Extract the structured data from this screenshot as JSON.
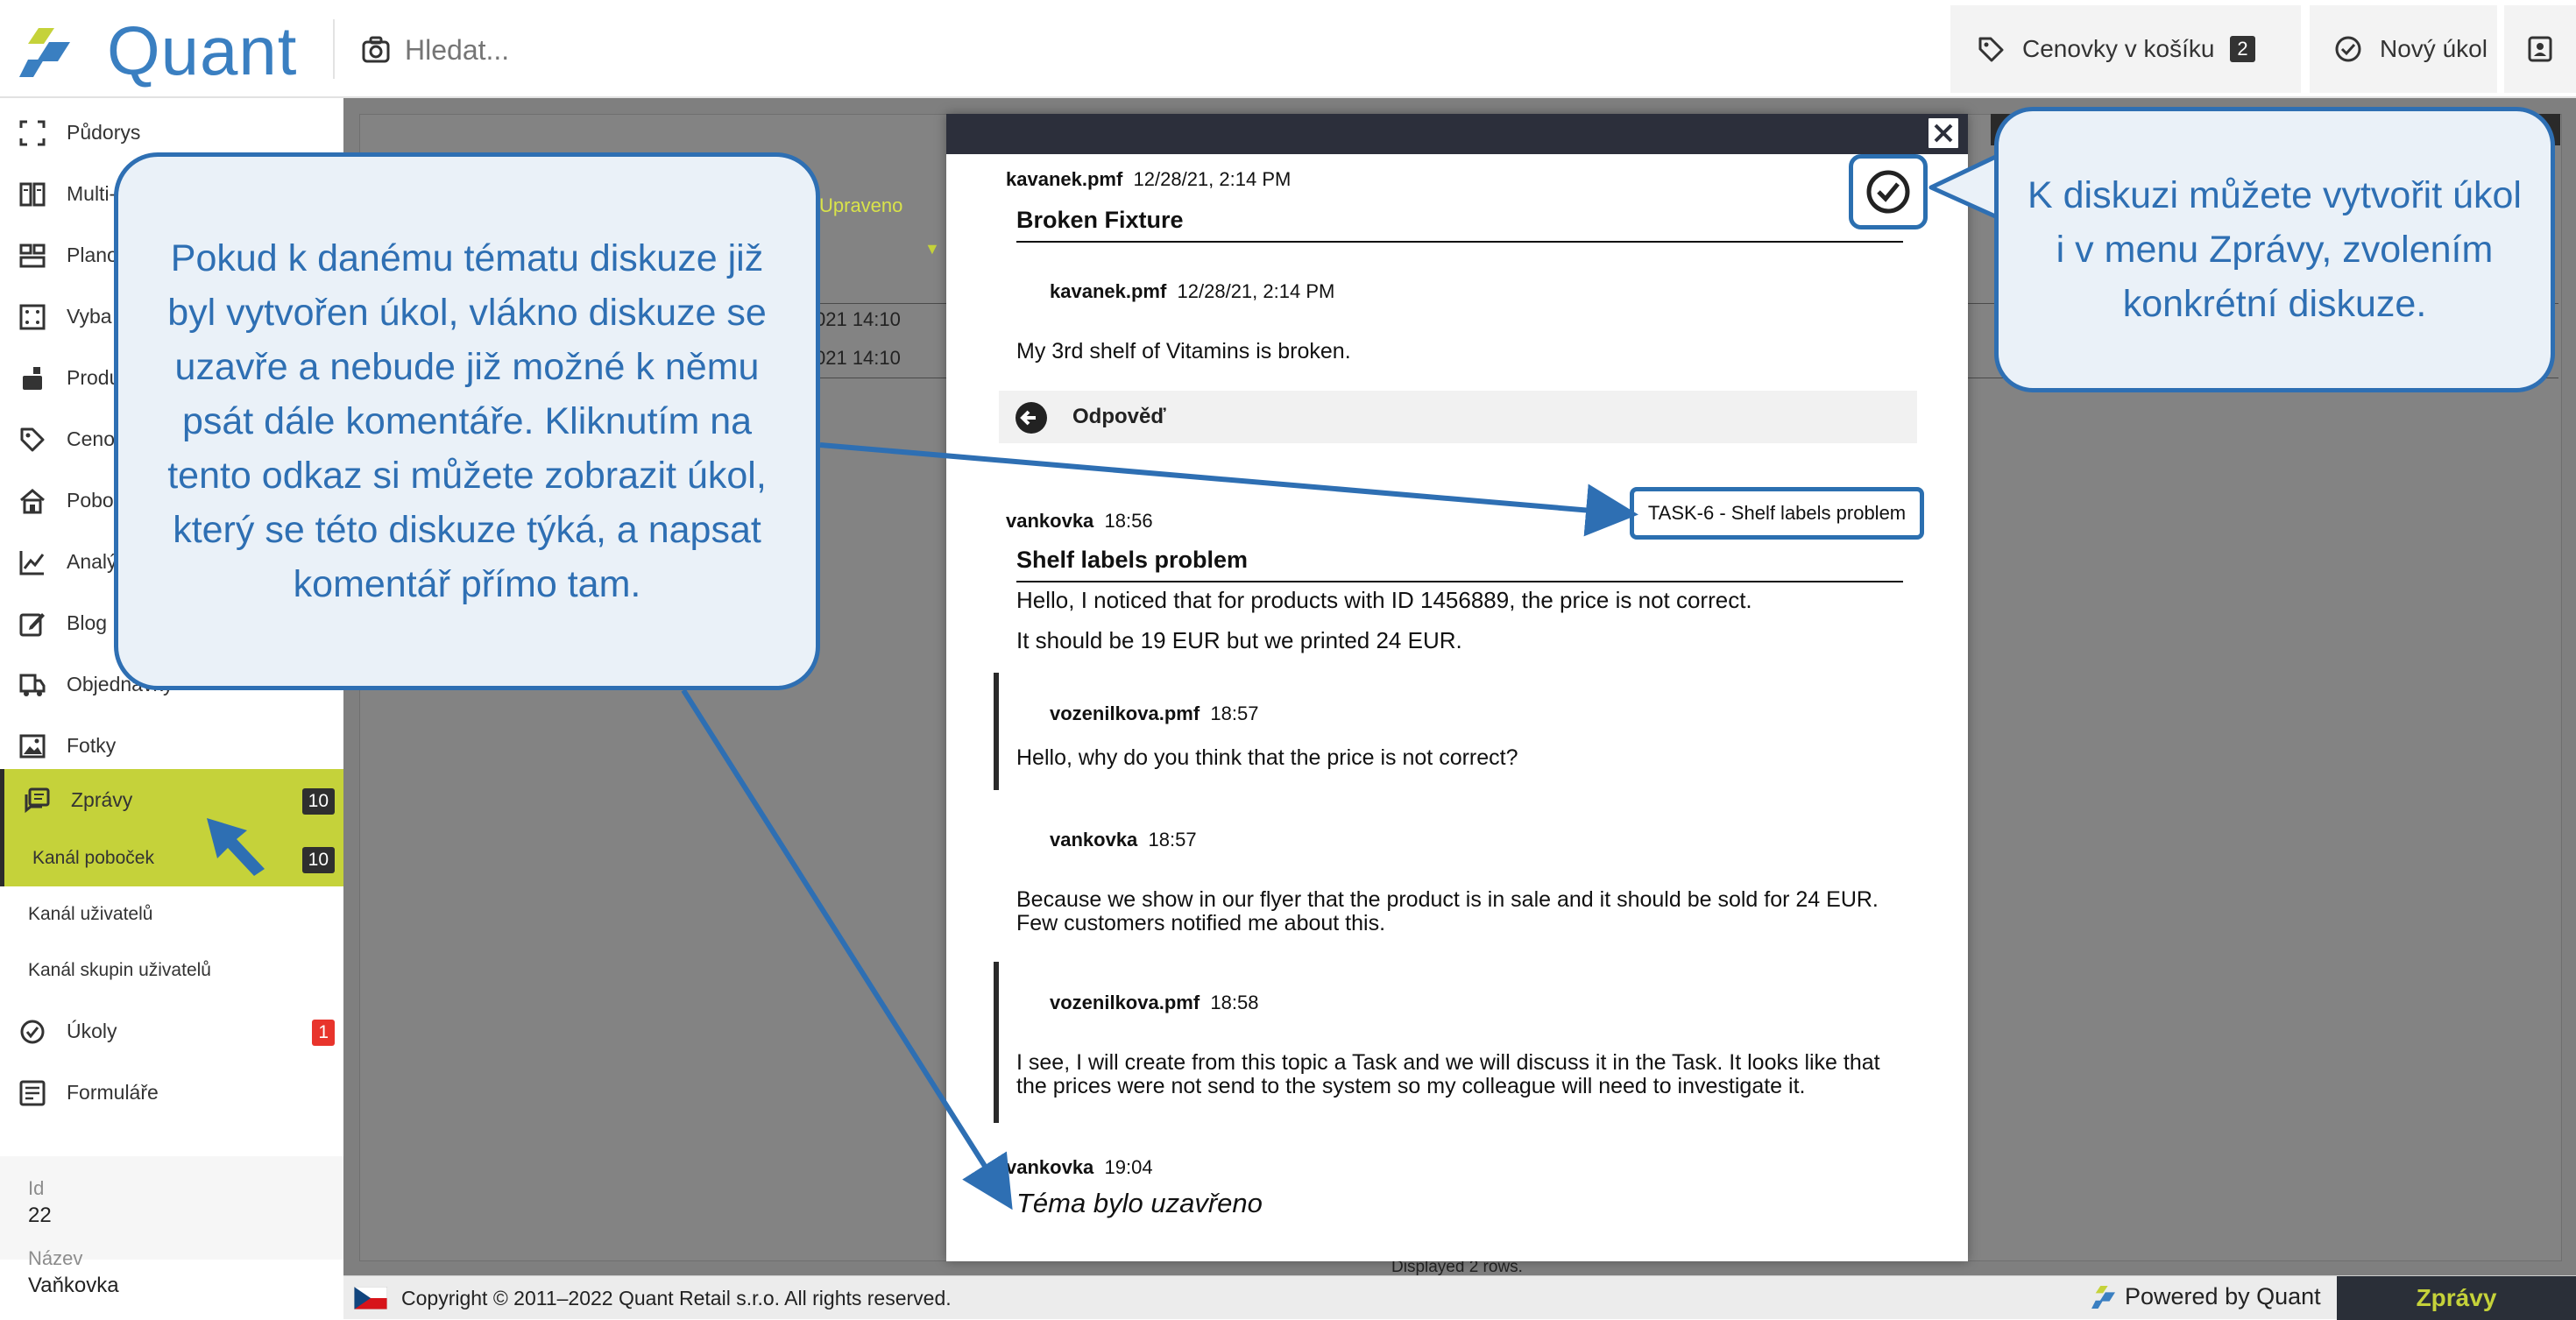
{
  "header": {
    "logo_text": "Quant",
    "search_placeholder": "Hledat...",
    "cart_label": "Cenovky v košíku",
    "cart_count": "2",
    "new_task_label": "Nový úkol"
  },
  "sidebar": {
    "items": [
      {
        "label": "Půdorys"
      },
      {
        "label": "Multi-vy"
      },
      {
        "label": "Plano"
      },
      {
        "label": "Vyba"
      },
      {
        "label": "Produ"
      },
      {
        "label": "Ceno"
      },
      {
        "label": "Pobo"
      },
      {
        "label": "Analý"
      },
      {
        "label": "Blog"
      },
      {
        "label": "Objednávky"
      },
      {
        "label": "Fotky"
      },
      {
        "label": "Zprávy",
        "badge": "10"
      },
      {
        "label": "Úkoly",
        "badge": "1"
      },
      {
        "label": "Formuláře"
      }
    ],
    "subitems": [
      {
        "label": "Kanál poboček",
        "badge": "10"
      },
      {
        "label": "Kanál uživatelů"
      },
      {
        "label": "Kanál skupin uživatelů"
      }
    ],
    "fields": [
      {
        "label": "Id",
        "value": "22"
      },
      {
        "label": "Název",
        "value": "Vaňkovka"
      }
    ]
  },
  "background_table": {
    "column_header": "Upraveno",
    "rows": [
      "021 14:10",
      "021 14:10"
    ],
    "footer": "Displayed 2 rows."
  },
  "dialog": {
    "topic1": {
      "author": "kavanek.pmf",
      "time": "12/28/21, 2:14 PM",
      "subject": "Broken Fixture",
      "reply_author": "kavanek.pmf",
      "reply_time": "12/28/21, 2:14 PM",
      "reply_body": "My 3rd shelf of Vitamins is broken."
    },
    "reply_button": "Odpověď",
    "topic2": {
      "author": "vankovka",
      "time": "18:56",
      "task_link": "TASK-6 - Shelf labels problem",
      "subject": "Shelf labels problem",
      "body_line1": "Hello, I noticed that for products with ID 1456889, the price is not correct.",
      "body_line2": "It should be 19 EUR but we printed 24 EUR.",
      "replies": [
        {
          "author": "vozenilkova.pmf",
          "time": "18:57",
          "body": "Hello, why do you think that the price is not correct?"
        },
        {
          "author": "vankovka",
          "time": "18:57",
          "body": "Because we show in our flyer that the product is in sale and it should be sold for 24 EUR. Few customers notified me about this."
        },
        {
          "author": "vozenilkova.pmf",
          "time": "18:58",
          "body": "I see, I will create from this topic a Task and we will discuss it in the Task. It looks like that the prices were not send to the system so my colleague will need to investigate it."
        }
      ],
      "closing_author": "vankovka",
      "closing_time": "19:04",
      "closing_text": "Téma bylo uzavřeno"
    }
  },
  "footer": {
    "copyright": "Copyright © 2011–2022 Quant Retail s.r.o. All rights reserved.",
    "powered": "Powered by Quant",
    "section": "Zprávy"
  },
  "callouts": {
    "left": "Pokud k danému tématu diskuze již byl vytvořen úkol, vlákno diskuze se uzavře a nebude již možné k němu psát dále komentáře. Kliknutím na tento odkaz si můžete zobrazit úkol, který se této diskuze týká, a napsat komentář přímo tam.",
    "right": "K diskuzi můžete vytvořit úkol i v menu Zprávy, zvolením konkrétní diskuze."
  },
  "colors": {
    "brand_blue": "#3a7fc1",
    "accent_lime": "#c5d23a",
    "callout_blue": "#2e6fb3",
    "badge_red": "#e8342c"
  },
  "icons": [
    "logo-icon",
    "camera-icon",
    "tag-icon",
    "check-circle-icon",
    "user-card-icon",
    "floorplan-icon",
    "multiview-icon",
    "planogram-icon",
    "equipment-icon",
    "products-icon",
    "pricetag-icon",
    "branch-icon",
    "analytics-icon",
    "blog-icon",
    "orders-icon",
    "photos-icon",
    "messages-icon",
    "tasks-icon",
    "forms-icon",
    "close-icon",
    "back-arrow-icon",
    "flag-cz-icon",
    "cursor-arrow-icon"
  ]
}
